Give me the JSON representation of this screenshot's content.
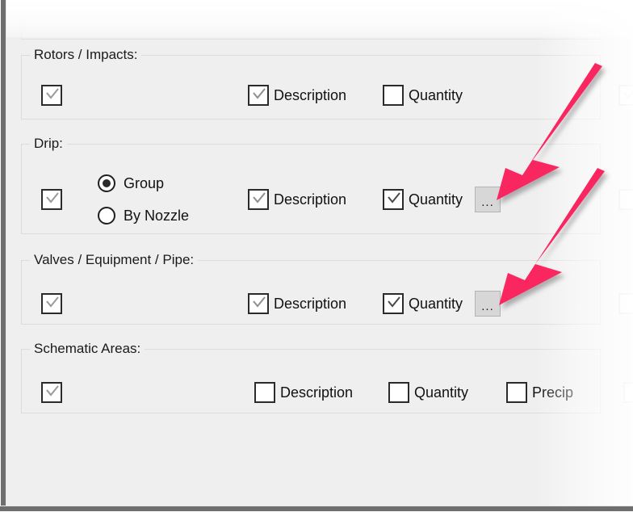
{
  "window": {
    "surface_color": "#efefef",
    "frame_color": "#6e6e6e"
  },
  "scrolled_off_group": {
    "radio_label": "By Nozzle"
  },
  "colors": {
    "arrow": "#f9275f",
    "checkbox_border": "#2b2b2b",
    "group_border": "#dcdcdc",
    "button_face": "#d7d7d7",
    "text": "#111111"
  },
  "groups": [
    {
      "title": "Rotors / Impacts:",
      "enable_checkbox": {
        "name": "rotors-impacts-enable-checkbox",
        "checked": true
      },
      "options": [
        {
          "label": "Description",
          "checked": true
        },
        {
          "label": "Quantity",
          "checked": false
        }
      ],
      "radios": [],
      "ellipsis_button": null
    },
    {
      "title": "Drip:",
      "enable_checkbox": {
        "name": "drip-enable-checkbox",
        "checked": true
      },
      "options": [
        {
          "label": "Description",
          "checked": true
        },
        {
          "label": "Quantity",
          "checked": true
        }
      ],
      "radios": [
        {
          "label": "Group",
          "selected": true
        },
        {
          "label": "By Nozzle",
          "selected": false
        }
      ],
      "ellipsis_button": {
        "label": "...",
        "name": "drip-quantity-options-button"
      }
    },
    {
      "title": "Valves / Equipment / Pipe:",
      "enable_checkbox": {
        "name": "valves-equipment-pipe-enable-checkbox",
        "checked": true
      },
      "options": [
        {
          "label": "Description",
          "checked": true
        },
        {
          "label": "Quantity",
          "checked": true
        }
      ],
      "radios": [],
      "ellipsis_button": {
        "label": "...",
        "name": "valves-quantity-options-button"
      }
    },
    {
      "title": "Schematic Areas:",
      "enable_checkbox": {
        "name": "schematic-areas-enable-checkbox",
        "checked": true
      },
      "options": [
        {
          "label": "Description",
          "checked": false
        },
        {
          "label": "Quantity",
          "checked": false
        },
        {
          "label": "Precip",
          "checked": false
        }
      ],
      "radios": [],
      "ellipsis_button": null
    }
  ],
  "annotations": [
    {
      "name": "arrow-to-drip-ellipsis-button",
      "color": "#f9275f"
    },
    {
      "name": "arrow-to-valves-ellipsis-button",
      "color": "#f9275f"
    }
  ]
}
